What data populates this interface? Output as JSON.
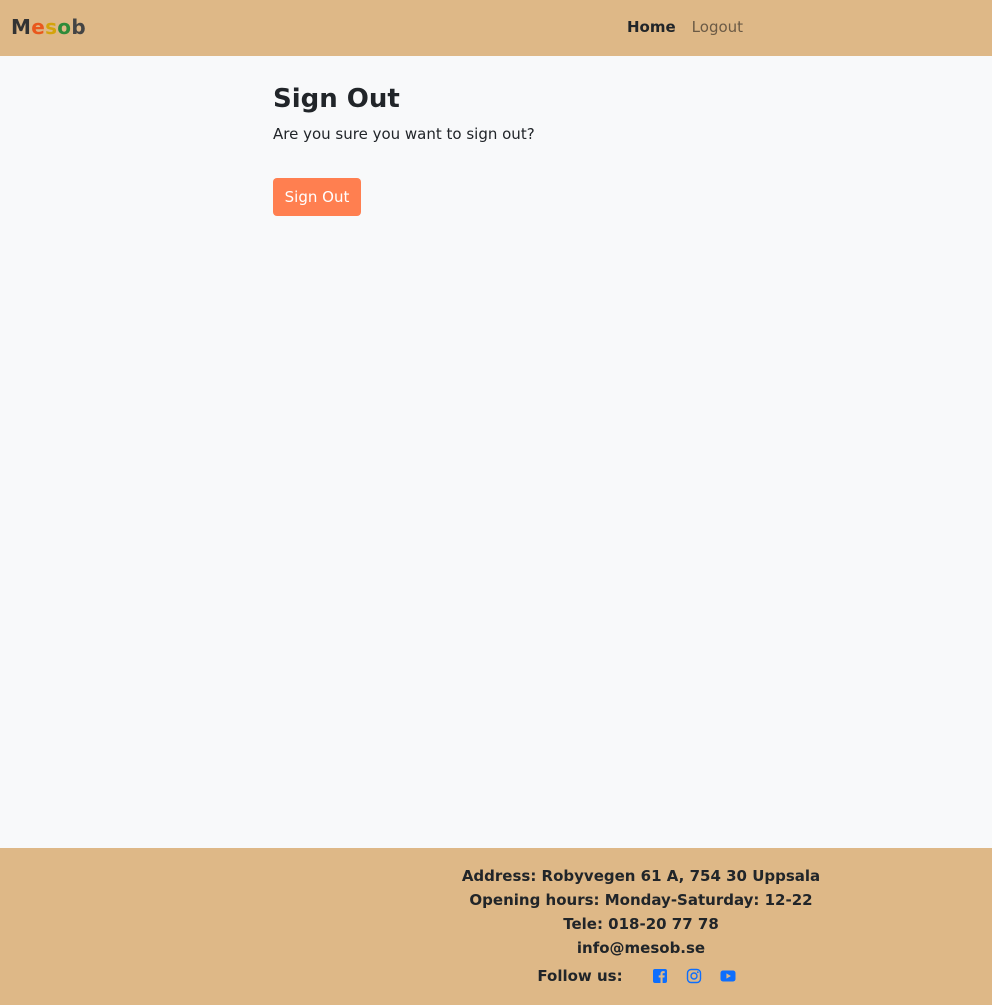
{
  "nav": {
    "brand_letters": [
      {
        "char": "M",
        "color": "#333333"
      },
      {
        "char": "e",
        "color": "#e9581d"
      },
      {
        "char": "s",
        "color": "#d4a30a"
      },
      {
        "char": "o",
        "color": "#2e8b3a"
      },
      {
        "char": "b",
        "color": "#444444"
      }
    ],
    "links": [
      {
        "label": "Home"
      },
      {
        "label": "Logout"
      }
    ]
  },
  "main": {
    "title": "Sign Out",
    "text": "Are you sure you want to sign out?",
    "button_label": "Sign Out"
  },
  "footer": {
    "address": "Address: Robyvegen 61 A, 754 30 Uppsala",
    "hours": "Opening hours: Monday-Saturday: 12-22",
    "tele": "Tele: 018-20 77 78",
    "email": "info@mesob.se",
    "follow_label": "Follow us:",
    "social_icons": [
      "facebook-icon",
      "instagram-icon",
      "youtube-icon"
    ]
  },
  "colors": {
    "header_bg": "#deb887",
    "body_bg": "#f8f9fa",
    "button_bg": "#ff7f50",
    "social_icon": "#0d6efd"
  }
}
